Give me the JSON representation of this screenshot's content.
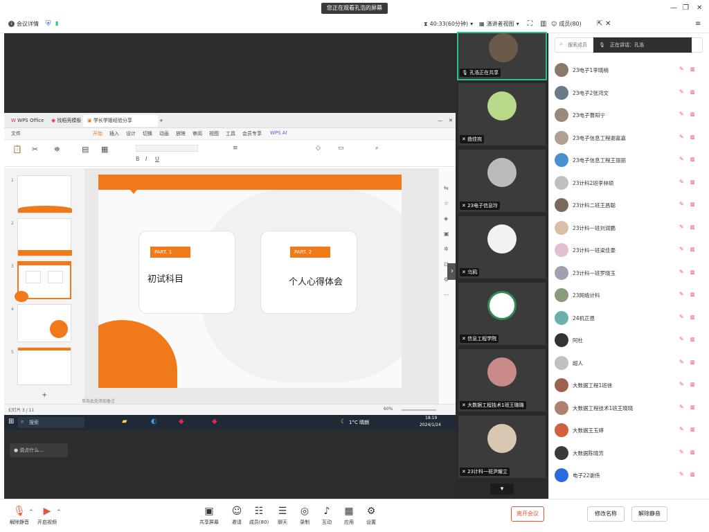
{
  "colors": {
    "accent": "#f07a1a",
    "active_speaker": "#2ec27e",
    "leave": "#e5533d"
  },
  "sharing_banner": "您正在观看孔浩的屏幕",
  "topbar": {
    "meeting_info": "会议详情",
    "timer": "40:33(60分钟)",
    "view_mode": "演讲者视图",
    "members": "成员(80)"
  },
  "wps": {
    "tabs": [
      "WPS Office",
      "找稻壳模板",
      "学长学姐经验分享"
    ],
    "menu": [
      "文件",
      "开始",
      "插入",
      "设计",
      "切换",
      "动画",
      "放映",
      "审阅",
      "视图",
      "工具",
      "会员专享",
      "WPS AI"
    ],
    "thumb_numbers": [
      "1",
      "2",
      "3",
      "4",
      "5"
    ],
    "slide": {
      "card1_tag": "PART. 1",
      "card1_title": "初试科目",
      "card2_tag": "PART. 2",
      "card2_title": "个人心得体会"
    },
    "status_left": "幻灯片 3 / 11",
    "notes_hint": "单击此处添加备注",
    "zoom": "60%",
    "taskbar_search": "搜索",
    "taskbar_weather": "1°C 晴朗",
    "taskbar_time": "18:19",
    "taskbar_date": "2024/1/24"
  },
  "hint_text": "说点什么...",
  "video_tiles": [
    {
      "label": "孔浩正在共享",
      "active": true
    },
    {
      "label": "曲佳宛",
      "active": false
    },
    {
      "label": "23电子信息玲",
      "active": false
    },
    {
      "label": "乌鸦",
      "active": false
    },
    {
      "label": "信息工程学院",
      "active": false
    },
    {
      "label": "大数据工程技术1班王璐璐",
      "active": false
    },
    {
      "label": "23计科一班尹耀立",
      "active": false
    }
  ],
  "right_panel": {
    "search_placeholder": "搜索成员",
    "speaking_label": "正在讲话：孔浩",
    "participants": [
      "23电子1李晓楠",
      "23电子2张鸿文",
      "23电子曹阳宁",
      "23电子信息工程谢嘉嘉",
      "23电子信息工程王丽丽",
      "23计科2班李林硕",
      "23计科二班王昌聪",
      "23计科一班刘润鹏",
      "23计科一班梁佳豪",
      "23计科一班罗晓玉",
      "23网络计科",
      "24机正恩",
      "阿杜",
      "超人",
      "大数据工程1班徐",
      "大数据工程技术1班王晓晓",
      "大数据王玉婷",
      "大数据陈晓芳",
      "电子22谢伟"
    ]
  },
  "bottombar": {
    "left": [
      {
        "label": "解除静音",
        "icon": "mic-muted-icon"
      },
      {
        "label": "开启视频",
        "icon": "video-off-icon"
      }
    ],
    "center": [
      {
        "label": "共享屏幕",
        "icon": "share-screen-icon"
      },
      {
        "label": "邀请",
        "icon": "invite-icon"
      },
      {
        "label": "成员(80)",
        "icon": "members-icon"
      },
      {
        "label": "聊天",
        "icon": "chat-icon"
      },
      {
        "label": "录制",
        "icon": "record-icon"
      },
      {
        "label": "互动",
        "icon": "reaction-icon"
      },
      {
        "label": "应用",
        "icon": "apps-icon"
      },
      {
        "label": "设置",
        "icon": "settings-icon"
      }
    ],
    "leave": "离开会议",
    "rename": "修改名称",
    "unmute_all": "解除静音"
  }
}
